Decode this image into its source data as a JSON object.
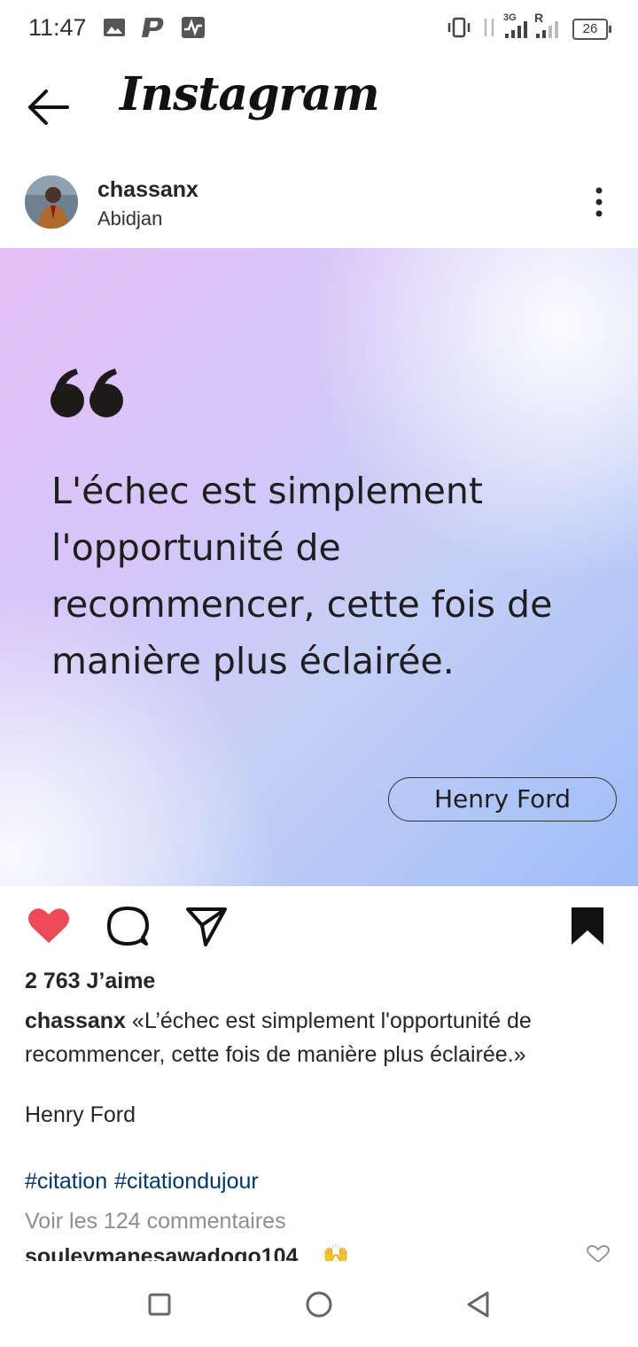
{
  "status_bar": {
    "time": "11:47",
    "network_label": "3G",
    "roaming_label": "R",
    "battery": "26"
  },
  "app": {
    "title": "Instagram"
  },
  "post": {
    "username": "chassanx",
    "location": "Abidjan",
    "image_quote": "L'échec est simplement l'opportunité de recommencer, cette fois de manière plus éclairée.",
    "image_author": "Henry Ford",
    "liked": true,
    "saved": true,
    "likes_text": "2 763 J’aime",
    "caption_user": "chassanx",
    "caption_text": "«L’échec est simplement l'opportunité de recommencer, cette fois de manière plus éclairée.»",
    "caption_author": "Henry Ford",
    "hashtags": [
      "#citation",
      "#citationdujour"
    ],
    "view_comments": "Voir les 124 commentaires",
    "first_comment_user": "souleymanesawadogo104",
    "first_comment_emoji": "🙌"
  },
  "colors": {
    "like_red": "#ed4956",
    "hashtag_blue": "#00376b",
    "muted_gray": "#8e8e8e"
  },
  "icons": {
    "back": "arrow-left-icon",
    "more": "more-vertical-icon",
    "like": "heart-icon",
    "comment": "comment-icon",
    "share": "send-icon",
    "save": "bookmark-icon"
  }
}
